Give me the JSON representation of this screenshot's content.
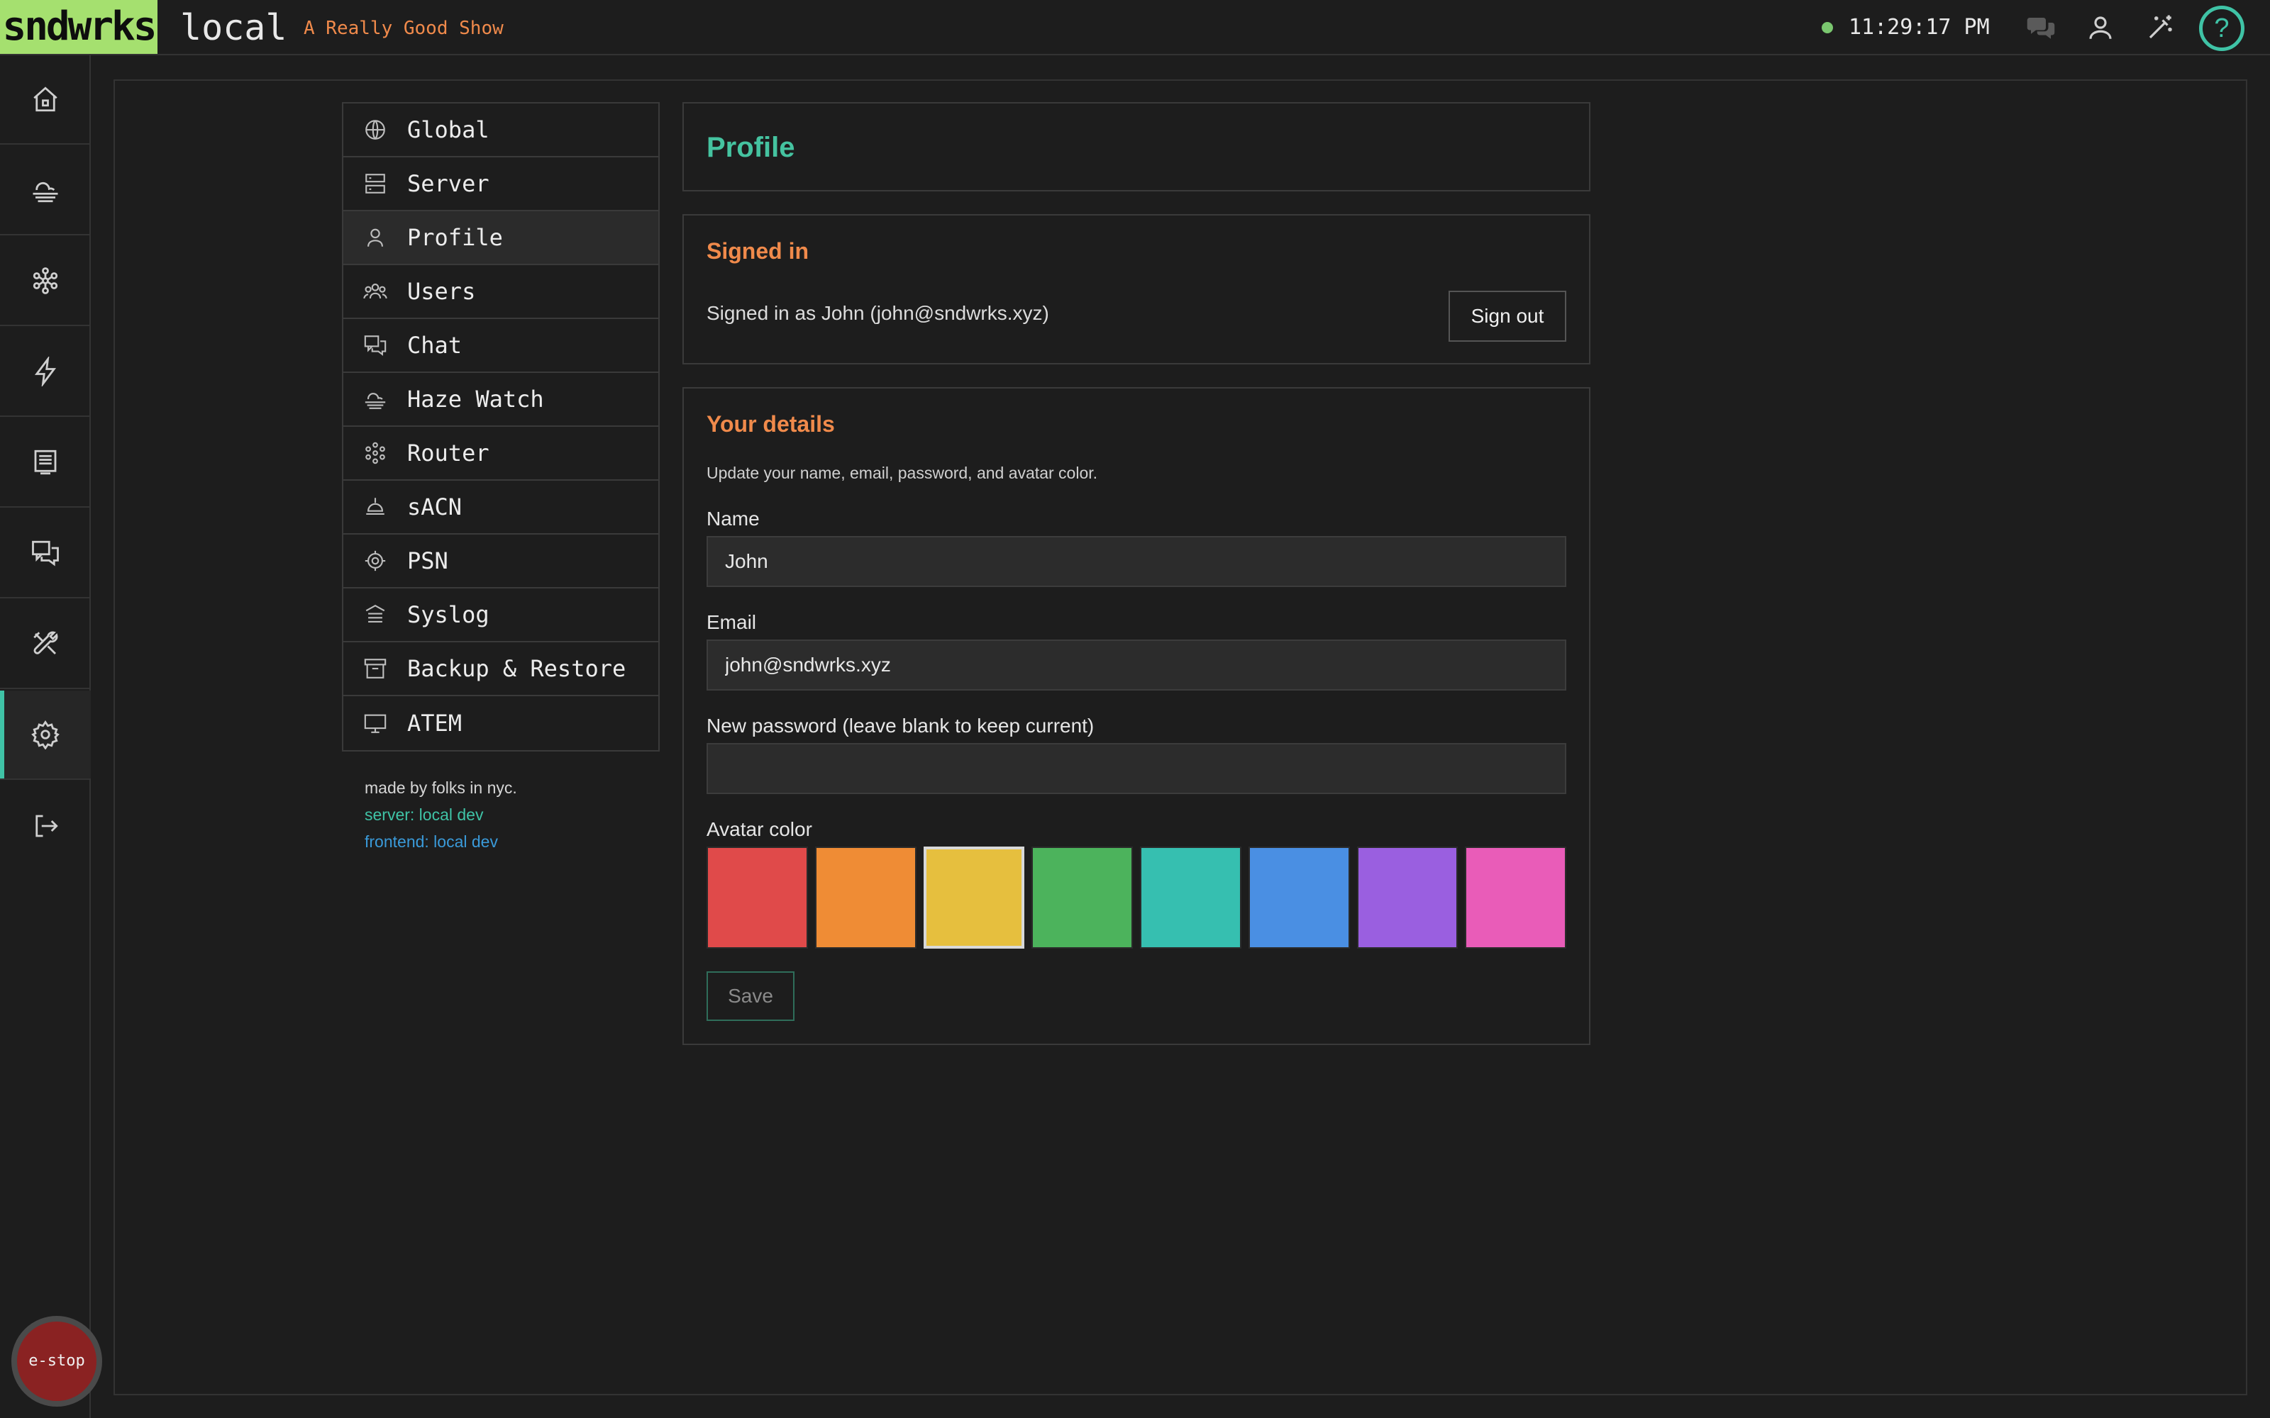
{
  "header": {
    "brand": "sndwrks",
    "environment": "local",
    "show_name": "A Really Good Show",
    "clock": "11:29:17 PM",
    "help_label": "?",
    "colors": {
      "brand_bg": "#a5e06f",
      "accent": "#3fc3a6",
      "show": "#f08a4b"
    }
  },
  "rail": {
    "items": [
      "home-icon",
      "haze-icon",
      "router-icon",
      "bolt-icon",
      "display-icon",
      "chat-icon",
      "tools-icon",
      "gear-icon",
      "logout-icon"
    ],
    "active": "gear-icon",
    "estop_label": "e-stop"
  },
  "settings_nav": {
    "items": [
      {
        "label": "Global",
        "icon": "globe-icon"
      },
      {
        "label": "Server",
        "icon": "server-icon"
      },
      {
        "label": "Profile",
        "icon": "user-icon"
      },
      {
        "label": "Users",
        "icon": "users-icon"
      },
      {
        "label": "Chat",
        "icon": "chat-icon"
      },
      {
        "label": "Haze Watch",
        "icon": "haze-icon"
      },
      {
        "label": "Router",
        "icon": "router-icon"
      },
      {
        "label": "sACN",
        "icon": "lamp-icon"
      },
      {
        "label": "PSN",
        "icon": "target-icon"
      },
      {
        "label": "Syslog",
        "icon": "syslog-icon"
      },
      {
        "label": "Backup & Restore",
        "icon": "archive-icon"
      },
      {
        "label": "ATEM",
        "icon": "monitor-icon"
      }
    ],
    "active": "Profile"
  },
  "credits": {
    "made": "made by folks in nyc.",
    "server": "server: local dev",
    "frontend": "frontend: local dev"
  },
  "profile": {
    "title": "Profile",
    "signed_in": {
      "title": "Signed in",
      "text": "Signed in as John (john@sndwrks.xyz)",
      "sign_out_label": "Sign out"
    },
    "details": {
      "title": "Your details",
      "description": "Update your name, email, password, and avatar color.",
      "name_label": "Name",
      "name_value": "John",
      "email_label": "Email",
      "email_value": "john@sndwrks.xyz",
      "password_label": "New password (leave blank to keep current)",
      "password_value": "",
      "avatar_label": "Avatar color",
      "avatar_colors": [
        "#e04a4a",
        "#ef8c35",
        "#e6bf3e",
        "#4cb35c",
        "#36bfb0",
        "#4a8fe3",
        "#9a5fe0",
        "#e95cb8"
      ],
      "selected_color": "#e6bf3e",
      "save_label": "Save"
    }
  }
}
